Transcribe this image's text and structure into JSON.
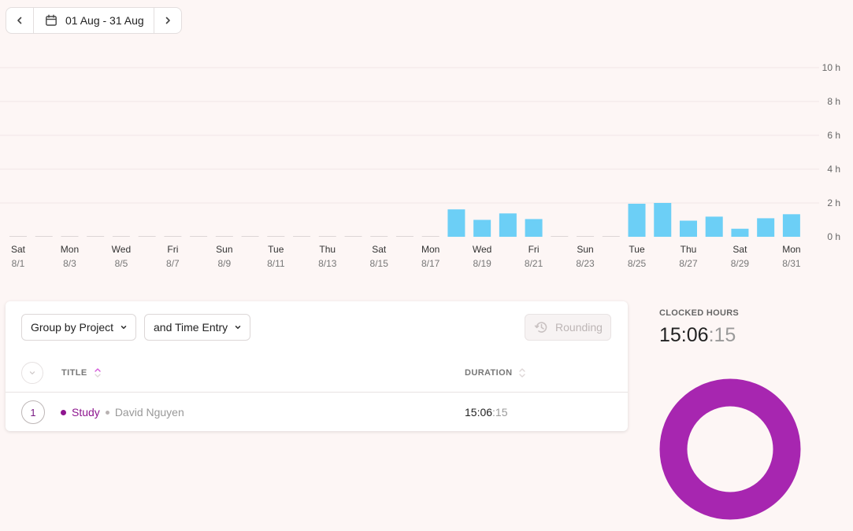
{
  "date_range": {
    "label": "01 Aug - 31 Aug"
  },
  "chart_data": {
    "type": "bar",
    "y_ticks": [
      "10 h",
      "8 h",
      "6 h",
      "4 h",
      "2 h",
      "0 h"
    ],
    "ylim": [
      0,
      10
    ],
    "color": "#6ccff6",
    "x_label_days": [
      "Sat",
      "Mon",
      "Wed",
      "Fri",
      "Sun",
      "Tue",
      "Thu",
      "Sat",
      "Mon",
      "Wed",
      "Fri",
      "Sun",
      "Tue",
      "Thu",
      "Sat",
      "Mon"
    ],
    "x_label_dates": [
      "8/1",
      "8/3",
      "8/5",
      "8/7",
      "8/9",
      "8/11",
      "8/13",
      "8/15",
      "8/17",
      "8/19",
      "8/21",
      "8/23",
      "8/25",
      "8/27",
      "8/29",
      "8/31"
    ],
    "categories": [
      "8/1",
      "8/2",
      "8/3",
      "8/4",
      "8/5",
      "8/6",
      "8/7",
      "8/8",
      "8/9",
      "8/10",
      "8/11",
      "8/12",
      "8/13",
      "8/14",
      "8/15",
      "8/16",
      "8/17",
      "8/18",
      "8/19",
      "8/20",
      "8/21",
      "8/22",
      "8/23",
      "8/24",
      "8/25",
      "8/26",
      "8/27",
      "8/28",
      "8/29",
      "8/30",
      "8/31"
    ],
    "values": [
      0,
      0,
      0,
      0,
      0,
      0,
      0,
      0,
      0,
      0,
      0,
      0,
      0,
      0,
      0,
      0,
      0,
      1.7,
      1.05,
      1.45,
      1.1,
      0,
      0,
      0,
      2.05,
      2.1,
      1.0,
      1.25,
      0.5,
      1.15,
      1.4
    ]
  },
  "toolbar": {
    "group_label": "Group by Project",
    "sub_group_label": "and Time Entry",
    "rounding_label": "Rounding"
  },
  "table": {
    "col_title": "TITLE",
    "col_duration": "DURATION",
    "rows": [
      {
        "count": "1",
        "project": "Study",
        "user": "David Nguyen",
        "duration_main": "15:06",
        "duration_secs": ":15",
        "color": "#8e168f"
      }
    ]
  },
  "summary": {
    "label": "CLOCKED HOURS",
    "value_main": "15:06",
    "value_secs": ":15",
    "donut_color": "#a726b0"
  }
}
